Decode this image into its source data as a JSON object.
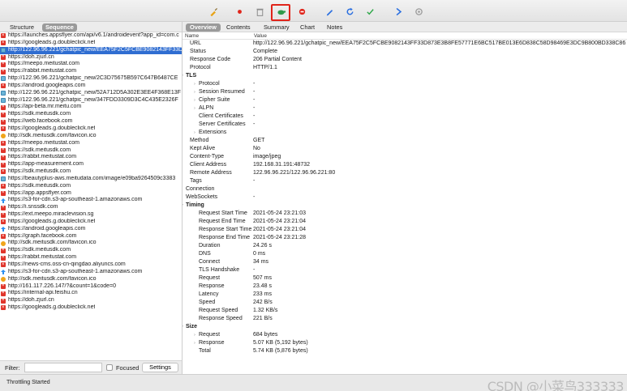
{
  "toolbar": {
    "buttons": [
      {
        "name": "broom-icon",
        "color": "#e8a316"
      },
      {
        "name": "record-icon",
        "color": "#e0241a"
      },
      {
        "name": "trash-icon",
        "color": "#8a8a8a"
      },
      {
        "name": "throttle-turtle-icon",
        "color": "#2f9a4a"
      },
      {
        "name": "stop-breakpoint-icon",
        "color": "#e0241a"
      },
      {
        "name": "pen-icon",
        "color": "#2b6fe0"
      },
      {
        "name": "refresh-icon",
        "color": "#2b6fe0"
      },
      {
        "name": "check-icon",
        "color": "#2fa84a"
      },
      {
        "name": "arrow-right-icon",
        "color": "#2b6fe0"
      },
      {
        "name": "settings-gear-icon",
        "color": "#9a9a9a"
      }
    ]
  },
  "left_tabs": {
    "structure": "Structure",
    "sequence": "Sequence"
  },
  "url_list": [
    {
      "icon": "error",
      "url": "https://launches.appsflyer.com/api/v6.1/androidevent?app_id=com.c"
    },
    {
      "icon": "error",
      "url": "https://googleads.g.doubleclick.net"
    },
    {
      "icon": "image",
      "url": "http://122.96.96.221/gchatpic_new/EEA75F2C5FCBE9082143FF33D",
      "selected": true
    },
    {
      "icon": "error",
      "url": "https://doh.zjurl.cn"
    },
    {
      "icon": "error",
      "url": "https://meepo.meitustat.com"
    },
    {
      "icon": "error",
      "url": "https://rabbit.meitustat.com"
    },
    {
      "icon": "image",
      "url": "http://122.96.96.221/gchatpic_new/2C3D75675B597C647B6487CE"
    },
    {
      "icon": "error",
      "url": "https://android.googleapis.com"
    },
    {
      "icon": "image",
      "url": "http://122.96.96.221/gchatpic_new/52A712D5A302E3EE4F368E13F"
    },
    {
      "icon": "image",
      "url": "http://122.96.96.221/gchatpic_new/347FDD3309D3C4C435E2326F"
    },
    {
      "icon": "error",
      "url": "https://api-beta.mr.meitu.com"
    },
    {
      "icon": "error",
      "url": "https://sdk.meitusdk.com"
    },
    {
      "icon": "error",
      "url": "https://web.facebook.com"
    },
    {
      "icon": "error",
      "url": "https://googleads.g.doubleclick.net"
    },
    {
      "icon": "warning",
      "url": "http://sdk.meitusdk.com/favicon.ico"
    },
    {
      "icon": "error",
      "url": "https://meepo.meitustat.com"
    },
    {
      "icon": "error",
      "url": "https://sdk.meitusdk.com"
    },
    {
      "icon": "error",
      "url": "https://rabbit.meitustat.com"
    },
    {
      "icon": "error",
      "url": "https://app-measurement.com"
    },
    {
      "icon": "error",
      "url": "https://sdk.meitusdk.com"
    },
    {
      "icon": "image",
      "url": "https://beautyplus-aws.meitudata.com/image/e09ba9264509c3383"
    },
    {
      "icon": "error",
      "url": "https://sdk.meitusdk.com"
    },
    {
      "icon": "error",
      "url": "https://app.appsflyer.com"
    },
    {
      "icon": "upload",
      "url": "https://s3-for-cdn.s3-ap-southeast-1.amazonaws.com"
    },
    {
      "icon": "error",
      "url": "https://i.snssdk.com"
    },
    {
      "icon": "error",
      "url": "https://ext.meepo.miraclevision.sg"
    },
    {
      "icon": "error",
      "url": "https://googleads.g.doubleclick.net"
    },
    {
      "icon": "upload",
      "url": "https://android.googleapis.com"
    },
    {
      "icon": "error",
      "url": "https://graph.facebook.com"
    },
    {
      "icon": "warning",
      "url": "http://sdk.meitusdk.com/favicon.ico"
    },
    {
      "icon": "error",
      "url": "https://sdk.meitusdk.com"
    },
    {
      "icon": "error",
      "url": "https://rabbit.meitustat.com"
    },
    {
      "icon": "error",
      "url": "https://news-cms.oss-cn-qingdao.aliyuncs.com"
    },
    {
      "icon": "upload",
      "url": "https://s3-for-cdn.s3-ap-southeast-1.amazonaws.com"
    },
    {
      "icon": "warning",
      "url": "http://sdk.meitusdk.com/favicon.ico"
    },
    {
      "icon": "error",
      "url": "http://161.117.226.147/?&count=1&code=0"
    },
    {
      "icon": "error",
      "url": "https://internal-api.feishu.cn"
    },
    {
      "icon": "error",
      "url": "https://doh.zjurl.cn"
    },
    {
      "icon": "error",
      "url": "https://googleads.g.doubleclick.net"
    }
  ],
  "filter": {
    "label": "Filter:",
    "value": "",
    "focused_label": "Focused",
    "settings_label": "Settings"
  },
  "right_tabs": [
    "Overview",
    "Contents",
    "Summary",
    "Chart",
    "Notes"
  ],
  "detail_header": {
    "name": "Name",
    "value": "Value"
  },
  "overview_rows": [
    {
      "key": "URL",
      "value": "http://122.96.96.221/gchatpic_new/EEA75F2C5FCBE9082143FF33D873E3B8FE57771E6BC517BE013E6D838C58D98469E3DC9B800BD338C86...",
      "level": 1
    },
    {
      "key": "Status",
      "value": "Complete",
      "level": 1
    },
    {
      "key": "Response Code",
      "value": "206 Partial Content",
      "level": 1
    },
    {
      "key": "Protocol",
      "value": "HTTP/1.1",
      "level": 1
    },
    {
      "key": "TLS",
      "value": "",
      "level": 0,
      "section": true,
      "expanded": true
    },
    {
      "key": "Protocol",
      "value": "-",
      "level": 2,
      "expandable": true
    },
    {
      "key": "Session Resumed",
      "value": "-",
      "level": 2,
      "expandable": true
    },
    {
      "key": "Cipher Suite",
      "value": "-",
      "level": 2,
      "expandable": true
    },
    {
      "key": "ALPN",
      "value": "-",
      "level": 2,
      "expandable": true
    },
    {
      "key": "Client Certificates",
      "value": "-",
      "level": 2
    },
    {
      "key": "Server Certificates",
      "value": "-",
      "level": 2
    },
    {
      "key": "Extensions",
      "value": "",
      "level": 2,
      "expandable": true
    },
    {
      "key": "Method",
      "value": "GET",
      "level": 1
    },
    {
      "key": "Kept Alive",
      "value": "No",
      "level": 1
    },
    {
      "key": "Content-Type",
      "value": "image/jpeg",
      "level": 1
    },
    {
      "key": "Client Address",
      "value": "192.168.31.191:48732",
      "level": 1
    },
    {
      "key": "Remote Address",
      "value": "122.96.96.221/122.96.96.221:80",
      "level": 1
    },
    {
      "key": "Tags",
      "value": "-",
      "level": 1
    },
    {
      "key": "Connection",
      "value": "",
      "level": 0,
      "expandable": true
    },
    {
      "key": "WebSockets",
      "value": "-",
      "level": 0,
      "expandable": true
    },
    {
      "key": "Timing",
      "value": "",
      "level": 0,
      "section": true,
      "expanded": true
    },
    {
      "key": "Request Start Time",
      "value": "2021-05-24 23:21:03",
      "level": 2
    },
    {
      "key": "Request End Time",
      "value": "2021-05-24 23:21:04",
      "level": 2
    },
    {
      "key": "Response Start Time",
      "value": "2021-05-24 23:21:04",
      "level": 2
    },
    {
      "key": "Response End Time",
      "value": "2021-05-24 23:21:28",
      "level": 2
    },
    {
      "key": "Duration",
      "value": "24.26 s",
      "level": 2
    },
    {
      "key": "DNS",
      "value": "0 ms",
      "level": 2
    },
    {
      "key": "Connect",
      "value": "34 ms",
      "level": 2
    },
    {
      "key": "TLS Handshake",
      "value": "-",
      "level": 2
    },
    {
      "key": "Request",
      "value": "507 ms",
      "level": 2
    },
    {
      "key": "Response",
      "value": "23.48 s",
      "level": 2
    },
    {
      "key": "Latency",
      "value": "233 ms",
      "level": 2
    },
    {
      "key": "Speed",
      "value": "242 B/s",
      "level": 2
    },
    {
      "key": "Request Speed",
      "value": "1.32 KB/s",
      "level": 2
    },
    {
      "key": "Response Speed",
      "value": "221 B/s",
      "level": 2
    },
    {
      "key": "Size",
      "value": "",
      "level": 0,
      "section": true,
      "expanded": true
    },
    {
      "key": "Request",
      "value": "684 bytes",
      "level": 2,
      "expandable": true
    },
    {
      "key": "Response",
      "value": "5.07 KB (5,192 bytes)",
      "level": 2,
      "expandable": true
    },
    {
      "key": "Total",
      "value": "5.74 KB (5,876 bytes)",
      "level": 2
    }
  ],
  "status_bar": {
    "text": "Throttling Started",
    "watermark": "CSDN @小菜鸟333333"
  },
  "colors": {
    "selection": "#2f6dd1",
    "highlight_box": "#e0241a"
  }
}
